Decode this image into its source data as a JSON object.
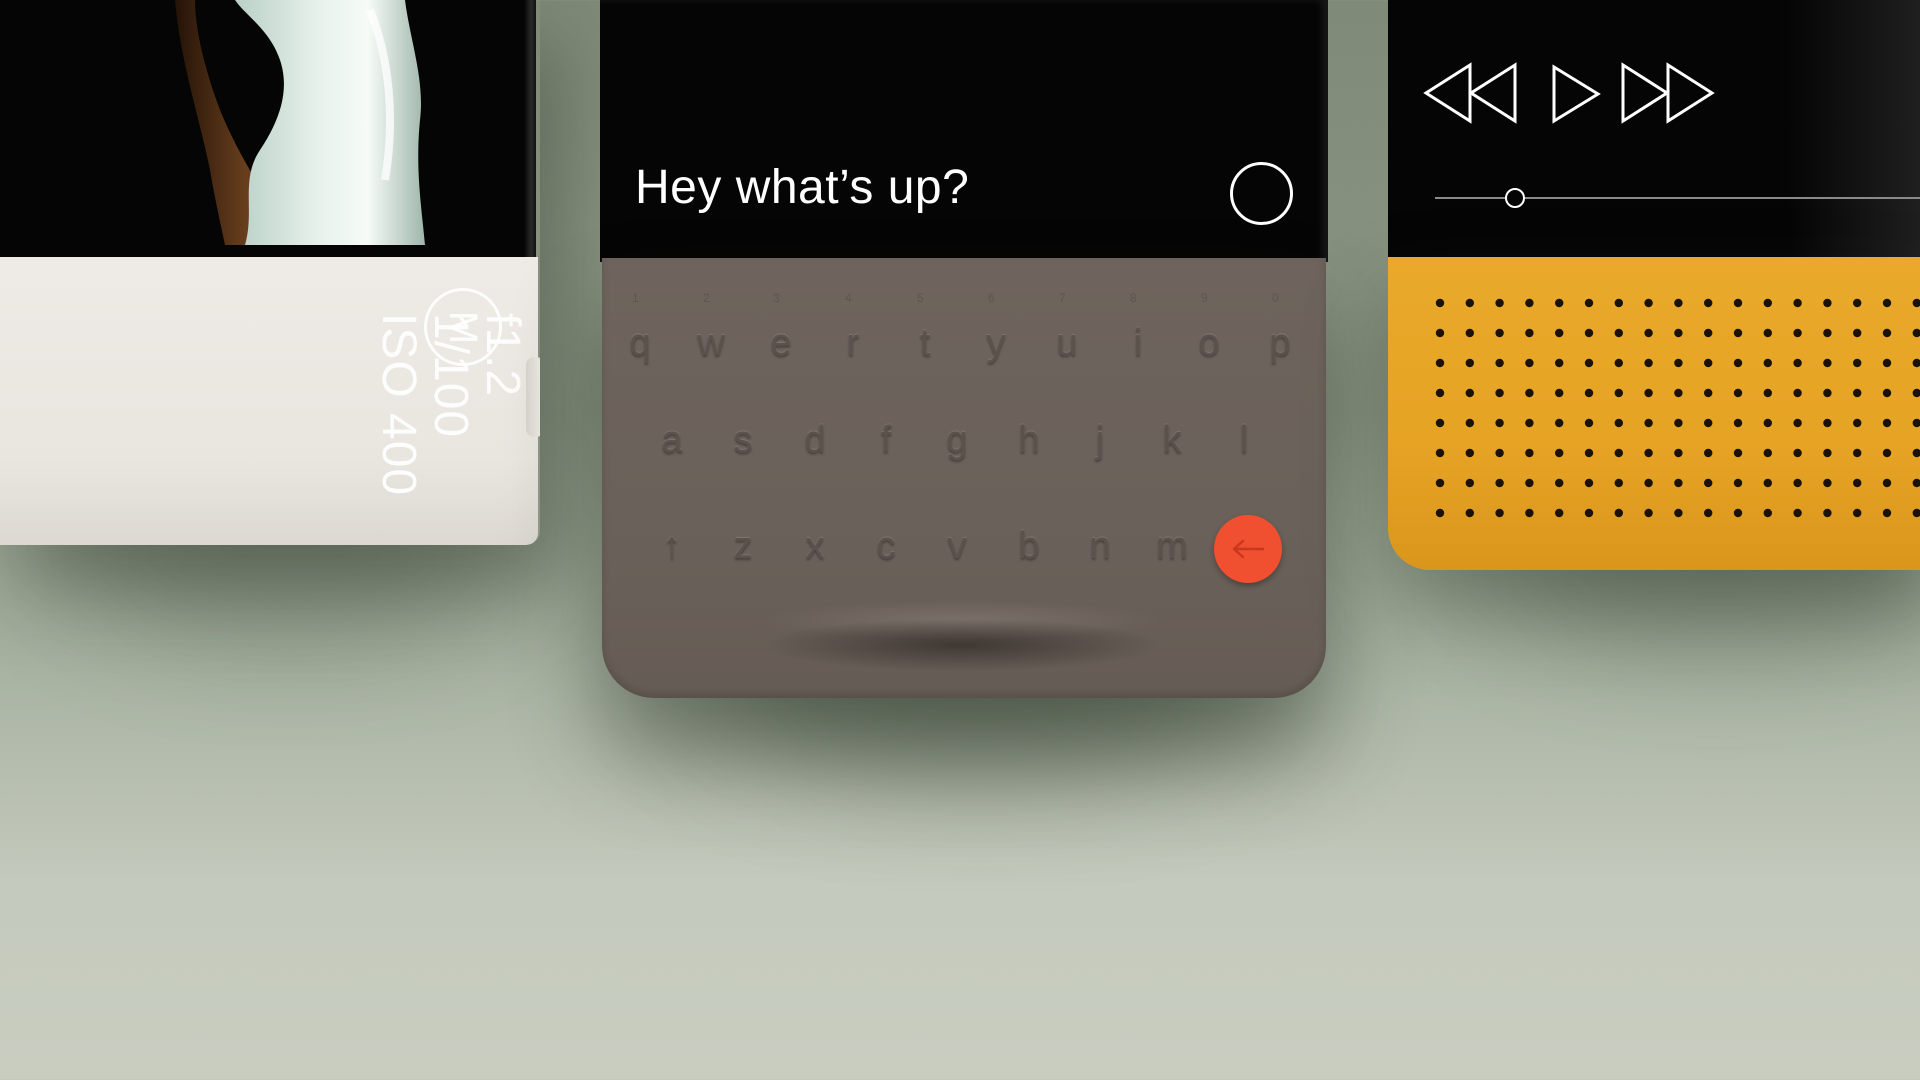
{
  "camera": {
    "mode_letter": "M",
    "exposure": [
      "f1.2",
      "1/100",
      "ISO 400"
    ]
  },
  "messaging": {
    "message": "Hey what’s up?"
  },
  "keyboard": {
    "row1": [
      {
        "letter": "q",
        "number": "1"
      },
      {
        "letter": "w",
        "number": "2"
      },
      {
        "letter": "e",
        "number": "3"
      },
      {
        "letter": "r",
        "number": "4"
      },
      {
        "letter": "t",
        "number": "5"
      },
      {
        "letter": "y",
        "number": "6"
      },
      {
        "letter": "u",
        "number": "7"
      },
      {
        "letter": "i",
        "number": "8"
      },
      {
        "letter": "o",
        "number": "9"
      },
      {
        "letter": "p",
        "number": "0"
      }
    ],
    "row2": [
      "a",
      "s",
      "d",
      "f",
      "g",
      "h",
      "j",
      "k",
      "l"
    ],
    "shift_symbol": "↑",
    "row3": [
      "z",
      "x",
      "c",
      "v",
      "b",
      "n",
      "m"
    ],
    "backspace_icon": "arrow-left-icon",
    "backspace_color": "#f0502f"
  },
  "music_player": {
    "controls": [
      "rewind-icon",
      "play-icon",
      "fast-forward-icon"
    ],
    "progress": 0.15
  },
  "colors": {
    "background": "#9aa593",
    "speaker": "#e6a324",
    "keyboard": "#6a615a",
    "camera_body": "#ebe8e2",
    "screen": "#050505"
  }
}
